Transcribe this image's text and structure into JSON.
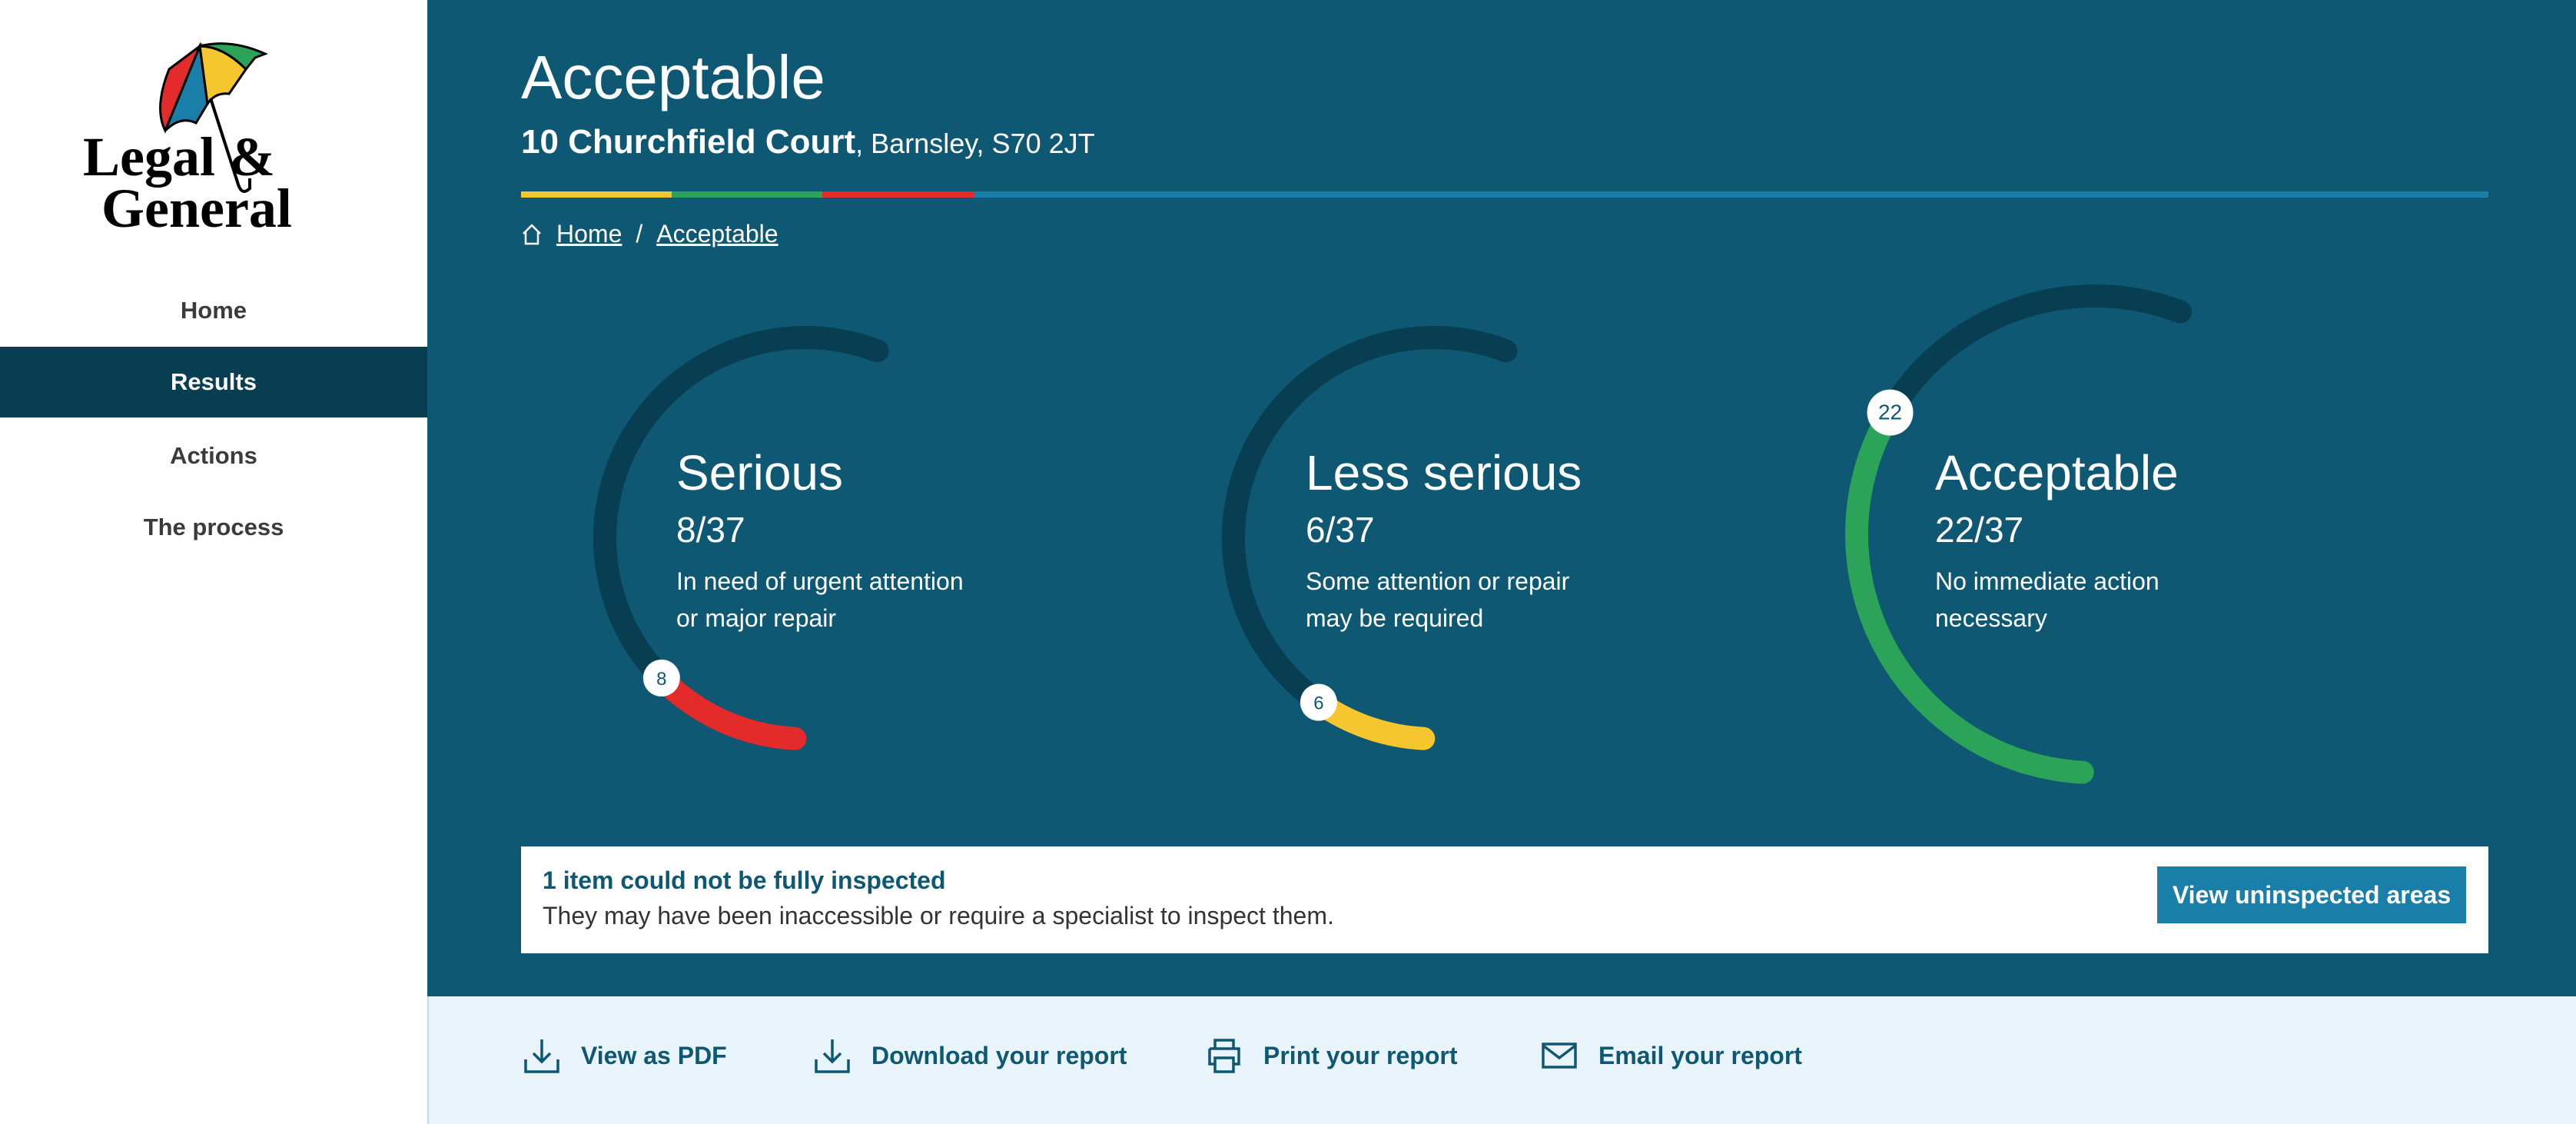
{
  "brand": {
    "logo_text_line1": "Legal &",
    "logo_text_line2": "General"
  },
  "sidebar": {
    "items": [
      {
        "label": "Home"
      },
      {
        "label": "Results",
        "active": true
      },
      {
        "label": "Actions"
      },
      {
        "label": "The process"
      }
    ]
  },
  "header": {
    "title": "Acceptable",
    "address_main": "10 Churchfield Court",
    "address_rest": ", Barnsley, S70 2JT",
    "stripe_colors": [
      "#f6c62e",
      "#2ba45a",
      "#e42b2b",
      "#1a7fa8"
    ]
  },
  "breadcrumb": {
    "icon": "home-icon",
    "items": [
      "Home",
      "Acceptable"
    ],
    "separator": "/"
  },
  "gauges": [
    {
      "title": "Serious",
      "count": 8,
      "total": 37,
      "fraction": "8/37",
      "desc_line1": "In need of urgent attention",
      "desc_line2": "or major repair",
      "badge": "8",
      "color": "#e42b2b"
    },
    {
      "title": "Less serious",
      "count": 6,
      "total": 37,
      "fraction": "6/37",
      "desc_line1": "Some attention or repair",
      "desc_line2": "may be required",
      "badge": "6",
      "color": "#f6c62e"
    },
    {
      "title": "Acceptable",
      "count": 22,
      "total": 37,
      "fraction": "22/37",
      "desc_line1": "No immediate action",
      "desc_line2": "necessary",
      "badge": "22",
      "color": "#2ba45a"
    }
  ],
  "banner": {
    "title": "1 item could not be fully inspected",
    "text": "They may have been inaccessible or require a specialist to inspect them.",
    "button": "View uninspected areas"
  },
  "footer": {
    "items": [
      {
        "label": "View as PDF",
        "icon": "download-icon"
      },
      {
        "label": "Download your report",
        "icon": "download-icon"
      },
      {
        "label": "Print your report",
        "icon": "printer-icon"
      },
      {
        "label": "Email your report",
        "icon": "mail-icon"
      }
    ]
  },
  "colors": {
    "main_bg": "#0f5873",
    "track": "#083e52",
    "active_nav": "#083e52",
    "button": "#1a7fa8",
    "footer_bg": "#e9f4fa"
  }
}
